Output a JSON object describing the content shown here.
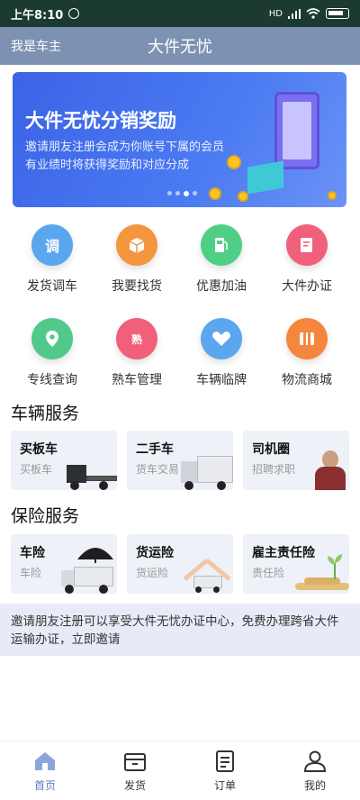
{
  "status_bar": {
    "time": "上午8:10",
    "network": "HD"
  },
  "header": {
    "left_label": "我是车主",
    "title": "大件无忧"
  },
  "banner": {
    "title": "大件无忧分销奖励",
    "line1": "邀请朋友注册会成为你账号下属的会员",
    "line2": "有业绩时将获得奖励和对应分成"
  },
  "grid": [
    {
      "label": "发货调车",
      "icon": "dispatch-icon",
      "color": "#5aa7ef",
      "glyph": "调"
    },
    {
      "label": "我要找货",
      "icon": "cargo-box-icon",
      "color": "#f4963d",
      "glyph": ""
    },
    {
      "label": "优惠加油",
      "icon": "fuel-icon",
      "color": "#4fcf86",
      "glyph": ""
    },
    {
      "label": "大件办证",
      "icon": "certificate-icon",
      "color": "#f0607a",
      "glyph": ""
    },
    {
      "label": "专线查询",
      "icon": "route-pin-icon",
      "color": "#50c98b",
      "glyph": ""
    },
    {
      "label": "熟车管理",
      "icon": "truck-manage-icon",
      "color": "#f0607a",
      "glyph": "熟"
    },
    {
      "label": "车辆临牌",
      "icon": "heart-plate-icon",
      "color": "#5aa7ef",
      "glyph": ""
    },
    {
      "label": "物流商城",
      "icon": "store-icon",
      "color": "#f4863d",
      "glyph": ""
    }
  ],
  "vehicle_section": {
    "title": "车辆服务",
    "cards": [
      {
        "title": "买板车",
        "subtitle": "买板车"
      },
      {
        "title": "二手车",
        "subtitle": "货车交易"
      },
      {
        "title": "司机圈",
        "subtitle": "招聘求职"
      }
    ]
  },
  "insurance_section": {
    "title": "保险服务",
    "cards": [
      {
        "title": "车险",
        "subtitle": "车险"
      },
      {
        "title": "货运险",
        "subtitle": "货运险"
      },
      {
        "title": "雇主责任险",
        "subtitle": "责任险"
      }
    ]
  },
  "notice": "邀请朋友注册可以享受大件无忧办证中心，免费办理跨省大件运输办证，立即邀请",
  "tabbar": [
    {
      "label": "首页",
      "icon": "home-icon",
      "active": true
    },
    {
      "label": "发货",
      "icon": "box-icon",
      "active": false
    },
    {
      "label": "订单",
      "icon": "document-icon",
      "active": false
    },
    {
      "label": "我的",
      "icon": "user-icon",
      "active": false
    }
  ],
  "colors": {
    "header": "#7d92b3",
    "status_bar": "#1b3a30",
    "accent": "#5a7fc6",
    "notice_bg": "#e9eaf7"
  }
}
